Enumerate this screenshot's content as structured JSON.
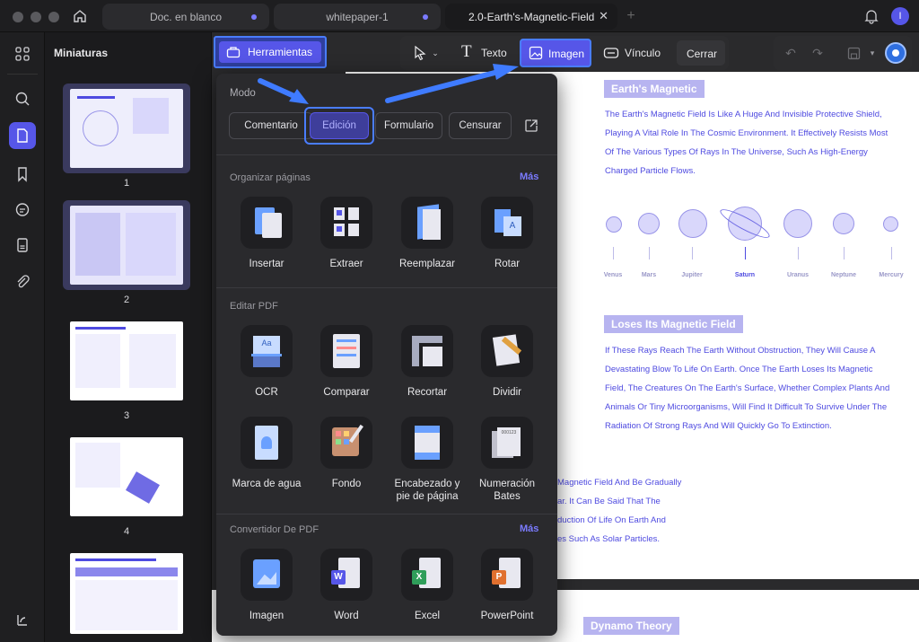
{
  "tabs": [
    {
      "label": "Doc. en blanco"
    },
    {
      "label": "whitepaper-1"
    },
    {
      "label": "2.0-Earth's-Magnetic-Field"
    }
  ],
  "sidebar": {
    "title": "Miniaturas",
    "pages": [
      "1",
      "2",
      "3",
      "4"
    ]
  },
  "toolbar": {
    "herramientas": "Herramientas",
    "texto": "Texto",
    "imagen": "Imagen",
    "vinculo": "Vínculo",
    "cerrar": "Cerrar"
  },
  "user_initial": "I",
  "popup": {
    "modo_title": "Modo",
    "modes": [
      "Comentario",
      "Edición",
      "Formulario",
      "Censurar"
    ],
    "organizar_title": "Organizar páginas",
    "organizar_more": "Más",
    "organizar_tools": [
      "Insertar",
      "Extraer",
      "Reemplazar",
      "Rotar"
    ],
    "editar_title": "Editar PDF",
    "editar_row1": [
      "OCR",
      "Comparar",
      "Recortar",
      "Dividir"
    ],
    "editar_row2": [
      "Marca de agua",
      "Fondo",
      "Encabezado y pie de página",
      "Numeración Bates"
    ],
    "convertidor_title": "Convertidor De PDF",
    "convertidor_more": "Más",
    "convertidor_tools": [
      "Imagen",
      "Word",
      "Excel",
      "PowerPoint"
    ]
  },
  "document": {
    "heading1": "Earth's Magnetic",
    "para1": [
      "The Earth's Magnetic Field Is Like A Huge And Invisible Protective Shield,",
      "Playing A Vital Role In The Cosmic Environment. It Effectively Resists Most",
      "Of The Various Types Of Rays In The Universe, Such As High-Energy",
      "Charged Particle Flows."
    ],
    "planets": [
      "Venus",
      "Mars",
      "Jupiter",
      "Saturn",
      "Uranus",
      "Neptune",
      "Mercury"
    ],
    "heading2": "Loses Its Magnetic Field",
    "para2": [
      "If These Rays Reach The Earth Without Obstruction, They Will Cause A",
      "Devastating Blow To Life On Earth. Once The Earth Loses Its Magnetic",
      "Field, The Creatures On The Earth's Surface, Whether Complex Plants And",
      "Animals Or Tiny Microorganisms, Will Find It Difficult To Survive Under The",
      "Radiation Of Strong Rays And Will Quickly Go To Extinction."
    ],
    "para3": [
      "Magnetic Field And Be Gradually",
      "ar. It Can Be Said That The",
      "duction Of Life On Earth And",
      "es Such As Solar Particles."
    ],
    "heading3": "Dynamo Theory"
  },
  "colors": {
    "accent": "#5656e8",
    "highlight": "#4a7dff",
    "doc_text": "#4e4ae0",
    "pill": "#b7b4f0"
  }
}
